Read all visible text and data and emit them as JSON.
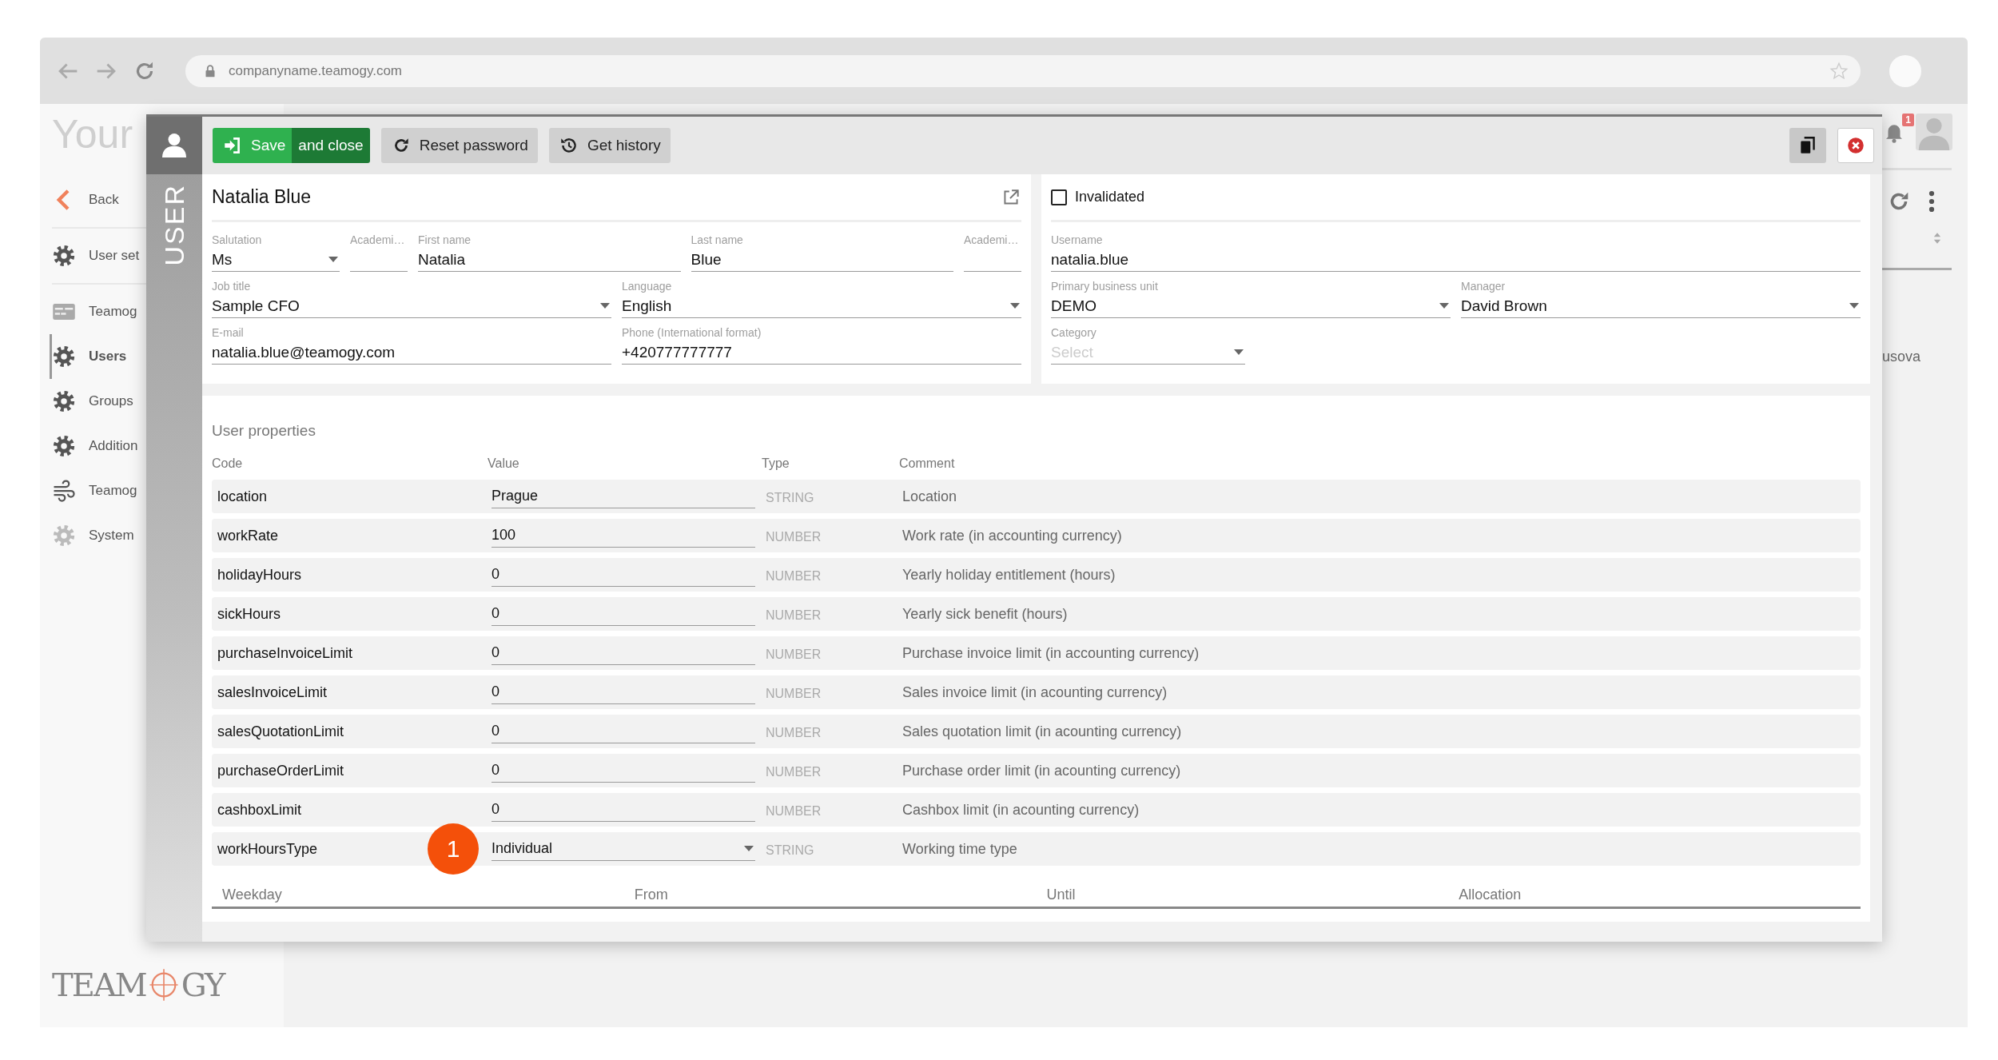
{
  "browser": {
    "url": "companyname.teamogy.com"
  },
  "sidebar": {
    "logo_text": "Your",
    "back": "Back",
    "items": [
      {
        "label": "User set",
        "kind": "gear",
        "selected": false
      },
      {
        "label": "Teamog",
        "kind": "card",
        "selected": false
      },
      {
        "label": "Users",
        "kind": "gear",
        "selected": true
      },
      {
        "label": "Groups",
        "kind": "gear",
        "selected": false
      },
      {
        "label": "Addition",
        "kind": "gear",
        "selected": false
      },
      {
        "label": "Teamog",
        "kind": "wind",
        "selected": false
      },
      {
        "label": "System",
        "kind": "faint",
        "selected": false
      }
    ],
    "footer_logo": {
      "left": "TEAM",
      "right": "GY"
    }
  },
  "background": {
    "notification_count": "1",
    "list_text": "usova"
  },
  "dialog": {
    "side_label": "USER",
    "toolbar": [
      {
        "kind": "save",
        "label": "Save"
      },
      {
        "kind": "save-close",
        "label": "and close"
      },
      {
        "kind": "reset",
        "label": "Reset password"
      },
      {
        "kind": "history",
        "label": "Get history"
      }
    ],
    "title": "Natalia Blue",
    "invalidated": {
      "label": "Invalidated",
      "checked": false
    },
    "left_fields": [
      [
        {
          "label": "Salutation",
          "value": "Ms",
          "kind": "select"
        },
        {
          "label": "Academi…",
          "kind": "input"
        },
        {
          "label": "First name",
          "value": "Natalia",
          "kind": "input"
        },
        {
          "label": "Last name",
          "value": "Blue",
          "kind": "input"
        },
        {
          "label": "Academi…",
          "kind": "input"
        }
      ],
      [
        {
          "label": "Job title",
          "value": "Sample CFO",
          "kind": "select"
        },
        {
          "label": "Language",
          "value": "English",
          "kind": "select"
        }
      ],
      [
        {
          "label": "E-mail",
          "value": "natalia.blue@teamogy.com",
          "kind": "input"
        },
        {
          "label": "Phone (International format)",
          "value": "+420777777777",
          "kind": "input"
        }
      ]
    ],
    "right_fields": [
      [
        {
          "label": "Username",
          "value": "natalia.blue",
          "kind": "input"
        }
      ],
      [
        {
          "label": "Primary business unit",
          "value": "DEMO",
          "kind": "select"
        },
        {
          "label": "Manager",
          "value": "David Brown",
          "kind": "select"
        }
      ],
      [
        {
          "label": "Category",
          "placeholder": "Select",
          "kind": "select"
        }
      ]
    ],
    "properties": {
      "title": "User properties",
      "columns": [
        "Code",
        "Value",
        "Type",
        "Comment"
      ],
      "rows": [
        {
          "code": "location",
          "value": "Prague",
          "kind": "input",
          "type": "STRING",
          "comment": "Location"
        },
        {
          "code": "workRate",
          "value": "100",
          "kind": "input",
          "type": "NUMBER",
          "comment": "Work rate (in accounting currency)"
        },
        {
          "code": "holidayHours",
          "value": "0",
          "kind": "input",
          "type": "NUMBER",
          "comment": "Yearly holiday entitlement (hours)"
        },
        {
          "code": "sickHours",
          "value": "0",
          "kind": "input",
          "type": "NUMBER",
          "comment": "Yearly sick benefit (hours)"
        },
        {
          "code": "purchaseInvoiceLimit",
          "value": "0",
          "kind": "input",
          "type": "NUMBER",
          "comment": "Purchase invoice limit (in accounting currency)"
        },
        {
          "code": "salesInvoiceLimit",
          "value": "0",
          "kind": "input",
          "type": "NUMBER",
          "comment": "Sales invoice limit (in acounting currency)"
        },
        {
          "code": "salesQuotationLimit",
          "value": "0",
          "kind": "input",
          "type": "NUMBER",
          "comment": "Sales quotation limit (in acounting currency)"
        },
        {
          "code": "purchaseOrderLimit",
          "value": "0",
          "kind": "input",
          "type": "NUMBER",
          "comment": "Purchase order limit (in acounting currency)"
        },
        {
          "code": "cashboxLimit",
          "value": "0",
          "kind": "input",
          "type": "NUMBER",
          "comment": "Cashbox limit (in acounting currency)"
        },
        {
          "code": "workHoursType",
          "value": "Individual",
          "kind": "select",
          "type": "STRING",
          "comment": "Working time type",
          "marker": "1"
        }
      ]
    },
    "schedule": {
      "columns": [
        "Weekday",
        "From",
        "Until",
        "Allocation"
      ]
    }
  }
}
